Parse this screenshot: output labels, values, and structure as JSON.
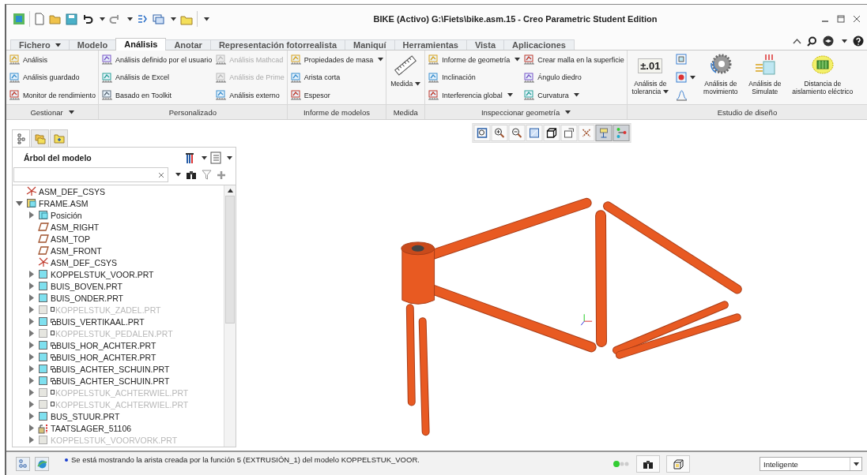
{
  "window": {
    "title": "BIKE (Activo) G:\\Fiets\\bike.asm.15 - Creo Parametric Student Edition"
  },
  "tabs": [
    {
      "label": "Fichero",
      "kind": "menu",
      "selected": false
    },
    {
      "label": "Modelo",
      "kind": "tab",
      "selected": false
    },
    {
      "label": "Análisis",
      "kind": "tab",
      "selected": true
    },
    {
      "label": "Anotar",
      "kind": "tab",
      "selected": false
    },
    {
      "label": "Representación fotorrealista",
      "kind": "tab",
      "selected": false
    },
    {
      "label": "Maniquí",
      "kind": "tab",
      "selected": false
    },
    {
      "label": "Herramientas",
      "kind": "tab",
      "selected": false
    },
    {
      "label": "Vista",
      "kind": "tab",
      "selected": false
    },
    {
      "label": "Aplicaciones",
      "kind": "tab",
      "selected": false
    }
  ],
  "ribbon": {
    "groups": [
      {
        "label": "Gestionar",
        "dropdown": true,
        "controls": [
          {
            "kind": "column",
            "items": [
              {
                "label": "Análisis",
                "disabled": false,
                "dropdown": false
              },
              {
                "label": "Análisis guardado",
                "disabled": false,
                "dropdown": false
              },
              {
                "label": "Monitor de rendimiento",
                "disabled": false,
                "dropdown": false
              }
            ]
          }
        ]
      },
      {
        "label": "Personalizado",
        "dropdown": false,
        "controls": [
          {
            "kind": "column",
            "items": [
              {
                "label": "Análisis definido por el usuario",
                "disabled": false,
                "dropdown": false
              },
              {
                "label": "Análisis de Excel",
                "disabled": false,
                "dropdown": false
              },
              {
                "label": "Basado en Toolkit",
                "disabled": false,
                "dropdown": false
              }
            ]
          },
          {
            "kind": "column",
            "items": [
              {
                "label": "Análisis Mathcad",
                "disabled": true,
                "dropdown": false
              },
              {
                "label": "Análisis de Prime",
                "disabled": true,
                "dropdown": false
              },
              {
                "label": "Análisis externo",
                "disabled": false,
                "dropdown": false
              }
            ]
          }
        ]
      },
      {
        "label": "Informe de modelos",
        "dropdown": false,
        "controls": [
          {
            "kind": "column",
            "items": [
              {
                "label": "Propiedades de masa",
                "disabled": false,
                "dropdown": true
              },
              {
                "label": "Arista corta",
                "disabled": false,
                "dropdown": false
              },
              {
                "label": "Espesor",
                "disabled": false,
                "dropdown": false
              }
            ]
          }
        ]
      },
      {
        "label": "Medida",
        "dropdown": false,
        "controls": [
          {
            "kind": "large",
            "label": "Medida",
            "dropdown": true
          }
        ]
      },
      {
        "label": "Inspeccionar geometría",
        "dropdown": true,
        "controls": [
          {
            "kind": "column",
            "items": [
              {
                "label": "Informe de geometría",
                "disabled": false,
                "dropdown": true
              },
              {
                "label": "Inclinación",
                "disabled": false,
                "dropdown": false
              },
              {
                "label": "Interferencia global",
                "disabled": false,
                "dropdown": true
              }
            ]
          },
          {
            "kind": "column",
            "items": [
              {
                "label": "Crear malla en la superficie",
                "disabled": false,
                "dropdown": false
              },
              {
                "label": "Ángulo diedro",
                "disabled": false,
                "dropdown": false
              },
              {
                "label": "Curvatura",
                "disabled": false,
                "dropdown": true
              }
            ]
          }
        ]
      },
      {
        "label": "Estudio de diseño",
        "dropdown": false,
        "controls": [
          {
            "kind": "large",
            "label": "Análisis de tolerancia",
            "dropdown": true,
            "icon_text": "±.01"
          },
          {
            "kind": "icons"
          },
          {
            "kind": "large",
            "label": "Análisis de movimiento",
            "dropdown": false
          },
          {
            "kind": "large",
            "label": "Análisis de Simulate",
            "dropdown": false
          },
          {
            "kind": "large",
            "label": "Distancia de aislamiento eléctrico",
            "dropdown": false
          }
        ]
      }
    ]
  },
  "view_toolbar": [
    {
      "selected": false
    },
    {
      "selected": false
    },
    {
      "selected": false
    },
    {
      "selected": false
    },
    {
      "selected": false
    },
    {
      "selected": false
    },
    {
      "selected": false
    },
    {
      "selected": true
    },
    {
      "selected": true
    }
  ],
  "panel_tabs": [
    {
      "selected": true
    },
    {
      "selected": false
    },
    {
      "selected": false
    }
  ],
  "model_tree": {
    "title": "Árbol del modelo",
    "items": [
      {
        "label": "ASM_DEF_CSYS",
        "kind": "csys"
      },
      {
        "label": "FRAME.ASM",
        "kind": "assembly",
        "expanded": true,
        "children": [
          {
            "label": "Posición",
            "kind": "folder",
            "expanded": false,
            "disabled": false,
            "square_mark": false,
            "link_mark": false
          },
          {
            "label": "ASM_RIGHT",
            "kind": "plane",
            "disabled": false,
            "square_mark": false,
            "link_mark": false
          },
          {
            "label": "ASM_TOP",
            "kind": "plane",
            "disabled": false,
            "square_mark": false,
            "link_mark": false
          },
          {
            "label": "ASM_FRONT",
            "kind": "plane",
            "disabled": false,
            "square_mark": false,
            "link_mark": false
          },
          {
            "label": "ASM_DEF_CSYS",
            "kind": "csys",
            "disabled": false,
            "square_mark": false,
            "link_mark": false
          },
          {
            "label": "KOPPELSTUK_VOOR.PRT",
            "kind": "part",
            "expanded": false,
            "disabled": false,
            "square_mark": false,
            "link_mark": false
          },
          {
            "label": "BUIS_BOVEN.PRT",
            "kind": "part",
            "expanded": false,
            "disabled": false,
            "square_mark": false,
            "link_mark": false
          },
          {
            "label": "BUIS_ONDER.PRT",
            "kind": "part",
            "expanded": false,
            "disabled": false,
            "square_mark": false,
            "link_mark": false
          },
          {
            "label": "KOPPELSTUK_ZADEL.PRT",
            "kind": "part",
            "expanded": false,
            "disabled": true,
            "square_mark": true,
            "link_mark": false
          },
          {
            "label": "BUIS_VERTIKAAL.PRT",
            "kind": "part",
            "expanded": false,
            "disabled": false,
            "square_mark": false,
            "link_mark": true
          },
          {
            "label": "KOPPELSTUK_PEDALEN.PRT",
            "kind": "part",
            "expanded": false,
            "disabled": true,
            "square_mark": true,
            "link_mark": false
          },
          {
            "label": "BUIS_HOR_ACHTER.PRT",
            "kind": "part",
            "expanded": false,
            "disabled": false,
            "square_mark": false,
            "link_mark": true
          },
          {
            "label": "BUIS_HOR_ACHTER.PRT",
            "kind": "part",
            "expanded": false,
            "disabled": false,
            "square_mark": false,
            "link_mark": true
          },
          {
            "label": "BUIS_ACHTER_SCHUIN.PRT",
            "kind": "part",
            "expanded": false,
            "disabled": false,
            "square_mark": false,
            "link_mark": true
          },
          {
            "label": "BUIS_ACHTER_SCHUIN.PRT",
            "kind": "part",
            "expanded": false,
            "disabled": false,
            "square_mark": false,
            "link_mark": true
          },
          {
            "label": "KOPPELSTUK_ACHTERWIEL.PRT",
            "kind": "part",
            "expanded": false,
            "disabled": true,
            "square_mark": true,
            "link_mark": false
          },
          {
            "label": "KOPPELSTUK_ACHTERWIEL.PRT",
            "kind": "part",
            "expanded": false,
            "disabled": true,
            "square_mark": true,
            "link_mark": false
          },
          {
            "label": "BUS_STUUR.PRT",
            "kind": "part",
            "expanded": false,
            "disabled": false,
            "square_mark": false,
            "link_mark": false
          },
          {
            "label": "TAATSLAGER_51106",
            "kind": "bearing",
            "expanded": false,
            "disabled": false,
            "square_mark": false,
            "link_mark": false
          },
          {
            "label": "KOPPELSTUK_VOORVORK.PRT",
            "kind": "part",
            "expanded": false,
            "disabled": true,
            "square_mark": false,
            "link_mark": false
          }
        ]
      }
    ]
  },
  "status_bar": {
    "message": "Se está mostrando la arista creada por la función 5 (EXTRUSIÓN_1) del modelo KOPPELSTUK_VOOR.",
    "filter": {
      "value": "Inteligente"
    }
  }
}
